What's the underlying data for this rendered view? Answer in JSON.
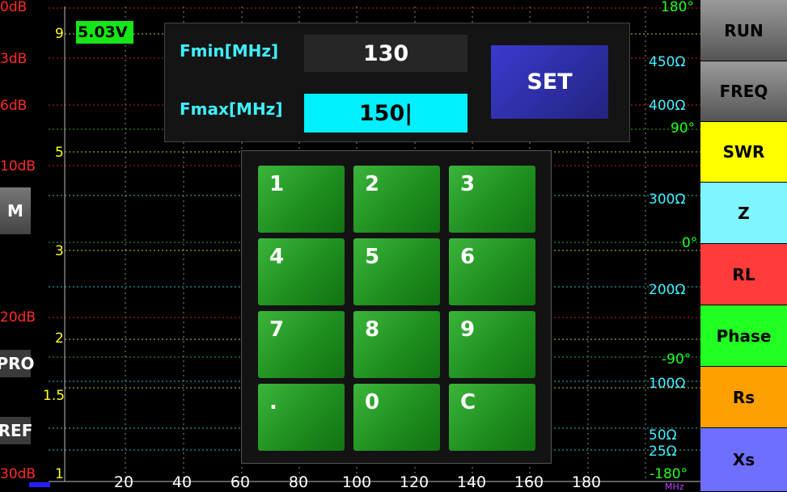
{
  "voltage": "5.03V",
  "left_labels": {
    "db": [
      "0dB",
      "3dB",
      "6dB",
      "10dB",
      "20dB",
      "30dB"
    ],
    "swr": [
      "9",
      "5",
      "3",
      "2",
      "1.5",
      "1"
    ]
  },
  "right_labels": {
    "phase": [
      "180°",
      "90°",
      "0°",
      "-90°",
      "-180°"
    ],
    "ohm": [
      "450Ω",
      "400Ω",
      "300Ω",
      "200Ω",
      "100Ω",
      "50Ω",
      "25Ω"
    ]
  },
  "x_axis": {
    "ticks": [
      "20",
      "40",
      "60",
      "80",
      "100",
      "120",
      "140",
      "160",
      "180"
    ],
    "unit": "MHz"
  },
  "left_buttons": {
    "m": "M",
    "pro": "PRO",
    "ref": "REF"
  },
  "side_buttons": [
    {
      "label": "RUN",
      "color": "#8a8a8a"
    },
    {
      "label": "FREQ",
      "color": "#8a8a8a"
    },
    {
      "label": "SWR",
      "color": "#ffff00"
    },
    {
      "label": "Z",
      "color": "#7ff6ff"
    },
    {
      "label": "RL",
      "color": "#ff3b3b"
    },
    {
      "label": "Phase",
      "color": "#22ff22"
    },
    {
      "label": "Rs",
      "color": "#ffa000"
    },
    {
      "label": "Xs",
      "color": "#6e6eff"
    }
  ],
  "freq_panel": {
    "fmin_label": "Fmin[MHz]",
    "fmin_value": "130",
    "fmax_label": "Fmax[MHz]",
    "fmax_value": "150|",
    "set_label": "SET"
  },
  "keypad": {
    "keys": [
      "1",
      "2",
      "3",
      "4",
      "5",
      "6",
      "7",
      "8",
      "9",
      ".",
      "0",
      "C"
    ]
  }
}
